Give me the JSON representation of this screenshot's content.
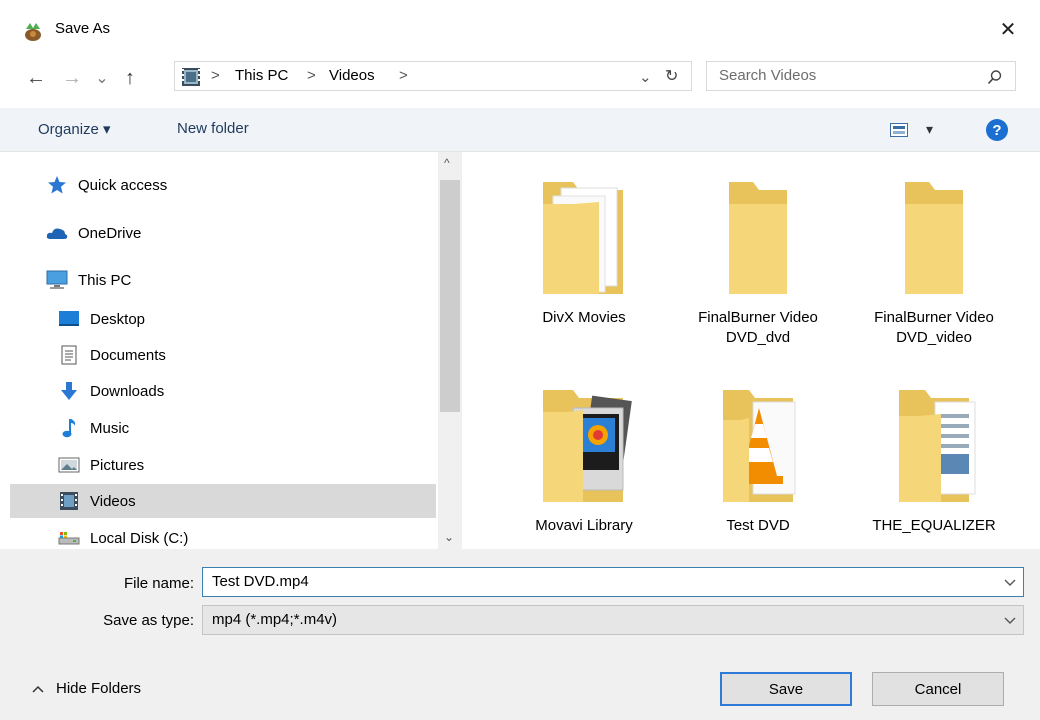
{
  "window": {
    "title": "Save As",
    "close_glyph": "✕"
  },
  "nav": {
    "back_glyph": "←",
    "forward_glyph": "→",
    "recent_glyph": "⌄",
    "up_glyph": "↑",
    "breadcrumbs": [
      "This PC",
      "Videos"
    ],
    "separator": ">",
    "refresh_glyph": "↻",
    "search_placeholder": "Search Videos"
  },
  "toolbar": {
    "organize_label": "Organize ▾",
    "new_folder_label": "New folder",
    "view_arrow": "▾",
    "help_glyph": "?"
  },
  "sidebar": {
    "items": [
      {
        "label": "Quick access",
        "icon": "star-icon"
      },
      {
        "label": "OneDrive",
        "icon": "cloud-icon"
      },
      {
        "label": "This PC",
        "icon": "computer-icon"
      },
      {
        "label": "Desktop",
        "icon": "desktop-icon"
      },
      {
        "label": "Documents",
        "icon": "documents-icon"
      },
      {
        "label": "Downloads",
        "icon": "download-icon"
      },
      {
        "label": "Music",
        "icon": "music-icon"
      },
      {
        "label": "Pictures",
        "icon": "pictures-icon"
      },
      {
        "label": "Videos",
        "icon": "videos-icon",
        "selected": true
      },
      {
        "label": "Local Disk (C:)",
        "icon": "disk-icon"
      }
    ]
  },
  "folders": [
    {
      "label": "DivX Movies"
    },
    {
      "label": "FinalBurner Video DVD_dvd"
    },
    {
      "label": "FinalBurner Video DVD_video"
    },
    {
      "label": "Movavi Library"
    },
    {
      "label": "Test DVD"
    },
    {
      "label": "THE_EQUALIZER"
    }
  ],
  "form": {
    "file_name_label": "File name:",
    "file_name_value": "Test DVD.mp4",
    "save_type_label": "Save as type:",
    "save_type_value": "mp4 (*.mp4;*.m4v)"
  },
  "footer": {
    "hide_folders_label": "Hide Folders",
    "save_label": "Save",
    "cancel_label": "Cancel"
  },
  "colors": {
    "accent": "#2f7ad6",
    "folder": "#f5d77a",
    "folder_dark": "#e8c25a",
    "selection": "#d9d9d9"
  }
}
